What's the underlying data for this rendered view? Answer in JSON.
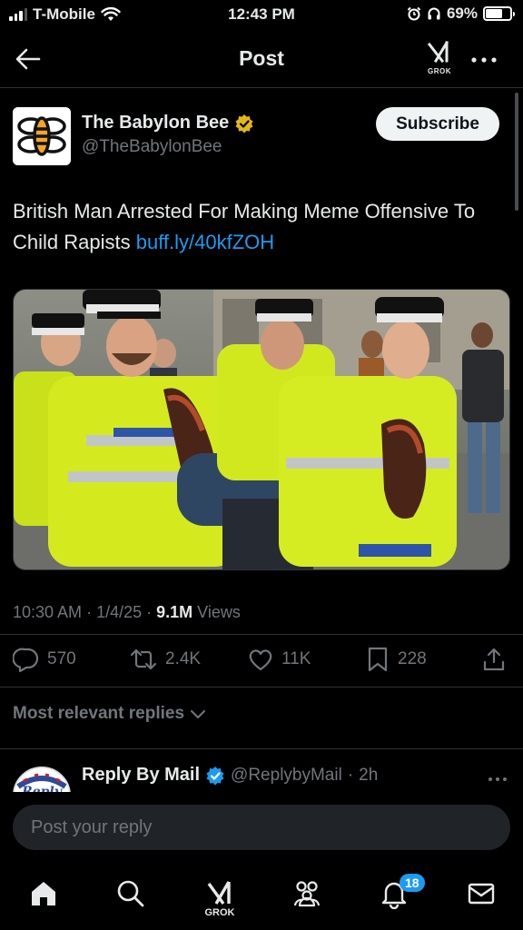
{
  "status_bar": {
    "carrier": "T-Mobile",
    "time": "12:43 PM",
    "battery": "69%",
    "battery_level": 0.69
  },
  "header": {
    "title": "Post",
    "grok_label": "GROK"
  },
  "post": {
    "author_name": "The Babylon Bee",
    "author_handle": "@TheBabylonBee",
    "subscribe_label": "Subscribe",
    "text": "British Man Arrested For Making Meme Offensive To Child Rapists ",
    "link": "buff.ly/40kfZOH",
    "time": "10:30 AM",
    "date": "1/4/25",
    "views_count": "9.1M",
    "views_label": "Views"
  },
  "actions": {
    "replies": "570",
    "reposts": "2.4K",
    "likes": "11K",
    "bookmarks": "228"
  },
  "replies_section": {
    "sort_label": "Most relevant replies"
  },
  "reply_preview": {
    "name": "Reply By Mail",
    "handle": "@ReplybyMail",
    "age": "2h",
    "avatar_text": "Reply"
  },
  "reply_input": {
    "placeholder": "Post your reply"
  },
  "bottom_nav": {
    "grok_label": "GROK",
    "notifications_badge": "18"
  },
  "colors": {
    "background": "#000000",
    "accent": "#1d9bf0",
    "text_primary": "#e7e9ea",
    "text_secondary": "#71767b",
    "verified_gold": "#e2b719"
  }
}
